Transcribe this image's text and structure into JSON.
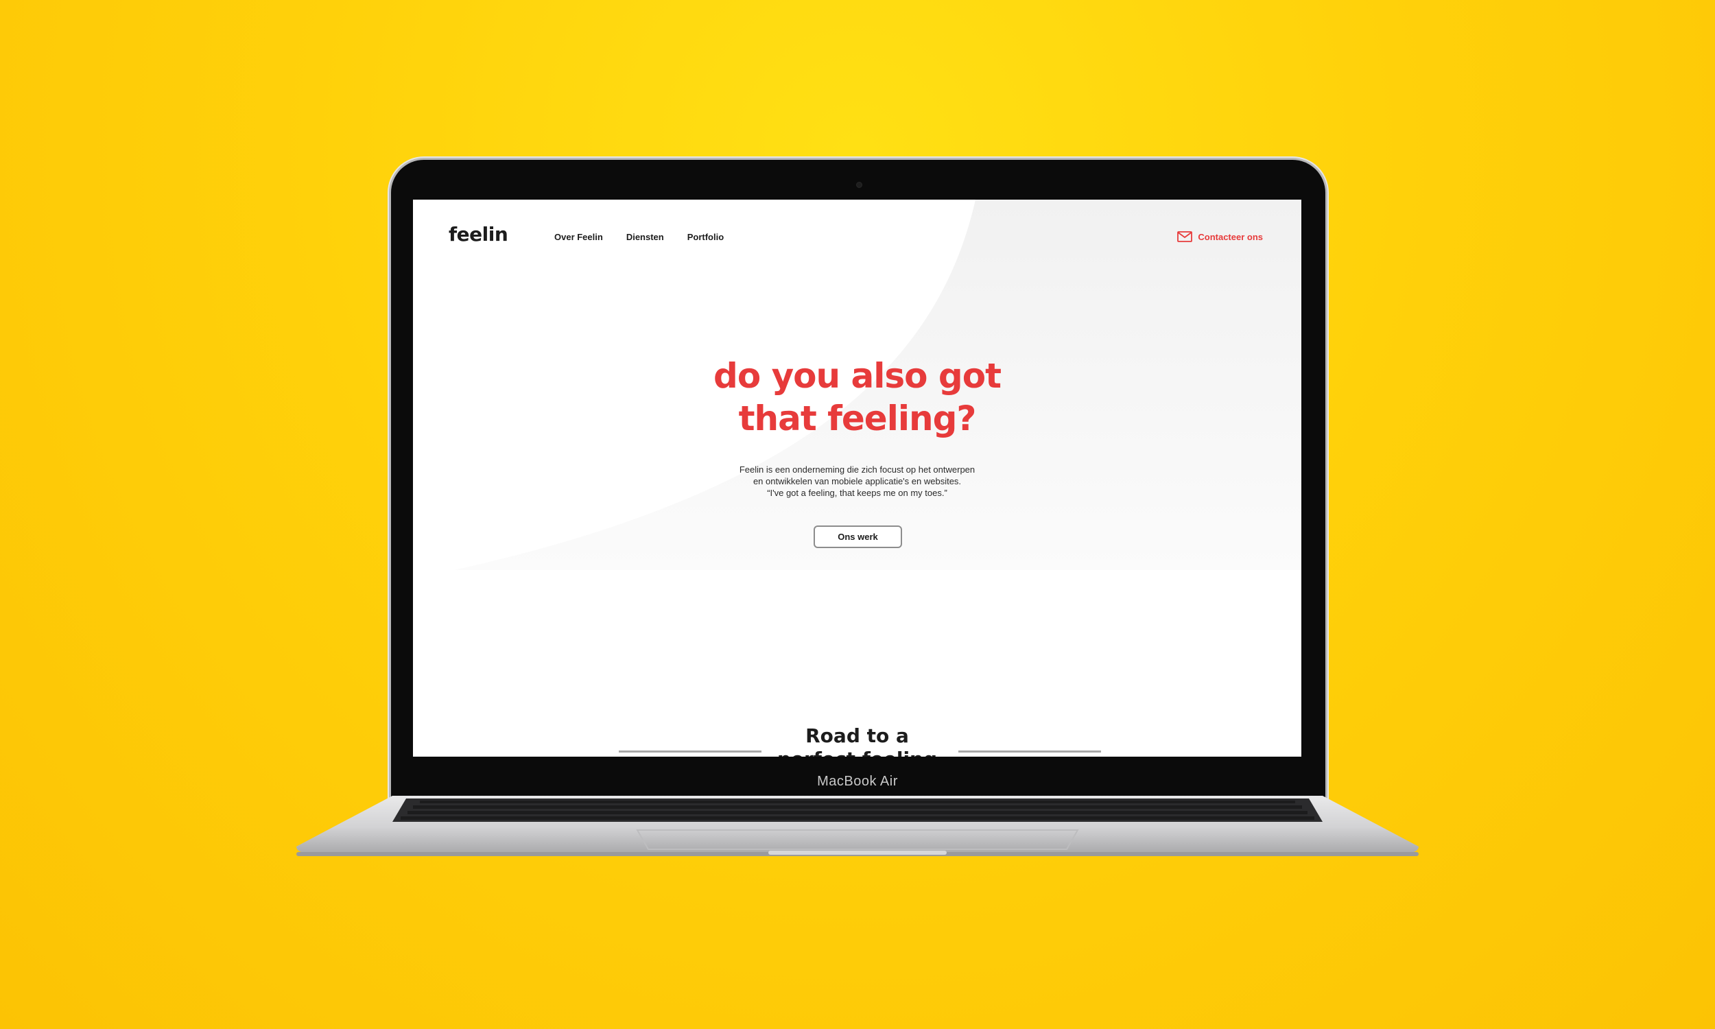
{
  "device": {
    "label": "MacBook Air"
  },
  "site": {
    "logo": "feelin",
    "nav": [
      {
        "label": "Over Feelin"
      },
      {
        "label": "Diensten"
      },
      {
        "label": "Portfolio"
      }
    ],
    "contact": {
      "label": "Contacteer ons",
      "icon": "mail-icon"
    },
    "hero": {
      "title_lines": [
        "do you also got",
        "that feeling?"
      ],
      "description_lines": [
        "Feelin is een onderneming die zich focust op het ontwerpen",
        "en ontwikkelen van mobiele applicatie's en websites.",
        "“I've got a feeling, that keeps me on my toes.”"
      ],
      "cta_label": "Ons werk"
    },
    "section": {
      "title_lines": [
        "Road to a",
        "perfect feeling"
      ]
    }
  },
  "colors": {
    "background": "#ffd10a",
    "accent": "#e73b3b",
    "text": "#1c1c1c"
  }
}
